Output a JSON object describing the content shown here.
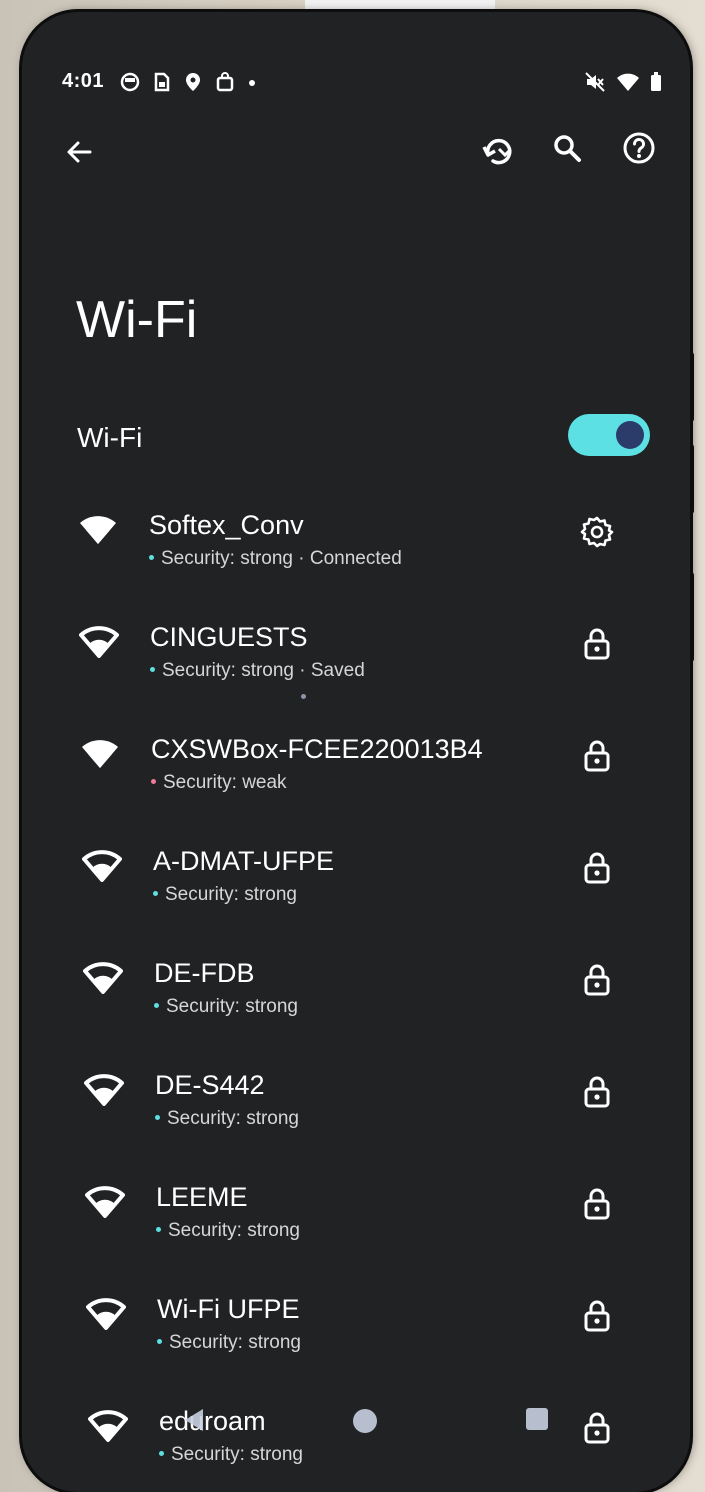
{
  "status_bar": {
    "time": "4:01",
    "left_icons": [
      "notification-circle-icon",
      "sim-icon",
      "location-pin-icon",
      "shopping-bag-icon",
      "more-dot-icon"
    ],
    "right_icons": [
      "mute-icon",
      "wifi-signal-icon",
      "battery-icon"
    ]
  },
  "toolbar": {
    "back_icon": "arrow-back-icon",
    "actions": [
      "refresh-icon",
      "search-icon",
      "help-icon"
    ]
  },
  "page": {
    "title": "Wi-Fi",
    "wifi_toggle_label": "Wi-Fi",
    "wifi_enabled": true
  },
  "colors": {
    "accent": "#5ce0e3",
    "toggle_knob": "#2b3c6a",
    "background": "#212224",
    "strong_dot": "#5ce0e3",
    "weak_dot": "#f07a9a"
  },
  "networks": [
    {
      "name": "Softex_Conv",
      "security": "Security: strong · Connected",
      "strength": "strong",
      "action_icon": "gear-icon"
    },
    {
      "name": "CINGUESTS",
      "security": "Security: strong · Saved",
      "strength": "strong",
      "action_icon": "lock-icon"
    },
    {
      "name": "CXSWBox-FCEE220013B4",
      "security": "Security: weak",
      "strength": "weak",
      "action_icon": "lock-icon"
    },
    {
      "name": "A-DMAT-UFPE",
      "security": "Security: strong",
      "strength": "strong",
      "action_icon": "lock-icon"
    },
    {
      "name": "DE-FDB",
      "security": "Security: strong",
      "strength": "strong",
      "action_icon": "lock-icon"
    },
    {
      "name": "DE-S442",
      "security": "Security: strong",
      "strength": "strong",
      "action_icon": "lock-icon"
    },
    {
      "name": "LEEME",
      "security": "Security: strong",
      "strength": "strong",
      "action_icon": "lock-icon"
    },
    {
      "name": "Wi-Fi UFPE",
      "security": "Security: strong",
      "strength": "strong",
      "action_icon": "lock-icon"
    },
    {
      "name": "eduroam",
      "security": "Security: strong",
      "strength": "strong",
      "action_icon": "lock-icon"
    }
  ],
  "navigation_bar": [
    "back-triangle-icon",
    "home-circle-icon",
    "recents-square-icon"
  ]
}
